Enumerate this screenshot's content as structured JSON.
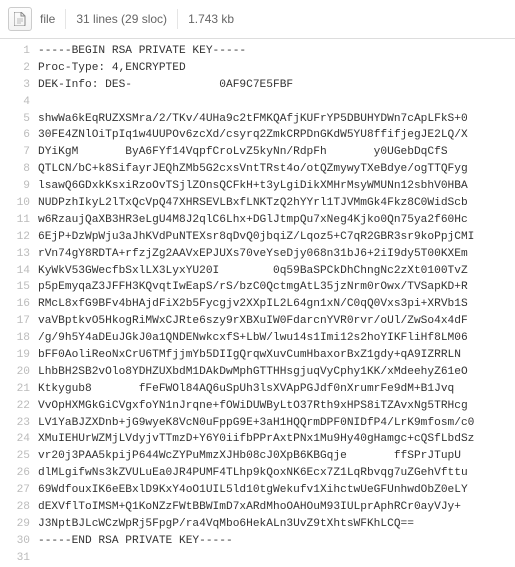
{
  "toolbar": {
    "filename": "file",
    "meta": "31 lines (29 sloc)",
    "size": "1.743 kb"
  },
  "code": {
    "lines": [
      "-----BEGIN RSA PRIVATE KEY-----",
      "Proc-Type: 4,ENCRYPTED",
      "DEK-Info: DES-             0AF9C7E5FBF",
      "",
      "shwWa6kEqRUZXSMra/2/TKv/4UHa9c2tFMKQAfjKUFrYP5DBUHYDWn7cApLFkS+0",
      "30FE4ZNlOiTpIq1w4UUPOv6zcXd/csyrq2ZmkCRPDnGKdW5YU8ffifjegJE2LQ/X",
      "DYiKgM       ByA6FYf14VqpfCroLvZ5kyNn/RdpFh       y0UGebDqCfS",
      "QTLCN/bC+k8SifayrJEQhZMb5G2cxsVntTRst4o/otQZmywyTXeBdye/ogTTQFyg",
      "lsawQ6GDxkKsxiRzoOvTSjlZOnsQCFkH+t3yLgiDikXMHrMsyWMUNn12sbhV0HBA",
      "NUDPzhIkyL2lTxQcVpQ47XHRSEVLBxfLNKTzQ2hYYrl1TJVMmGk4Fkz8C0WidScb",
      "w6RzaujQaXB3HR3eLgU4M8J2qlC6Lhx+DGlJtmpQu7xNeg4Kjko0Qn75ya2f60Hc",
      "6EjP+DzWpWju3aJhKVdPuNTEXsr8qDvQ0jbqiZ/Lqoz5+C7qR2GBR3sr9koPpjCMI",
      "rVn74gY8RDTA+rfzjZg2AAVxEPJUXs70veYseDjy068n31bJ6+2iI9dy5T00KXEm",
      "KyWkV53GWecfbSxlLX3LyxYU20I        0q59BaSPCkDhChngNc2zXt0100TvZ",
      "p5pEmyqaZ3JFFH3KQvqtIwEapS/rS/bzC0QctmgAtL35jzNrm0rOwx/TVSapKD+R",
      "RMcL8xfG9BFv4bHAjdFiX2b5Fycgjv2XXpIL2L64gn1xN/C0qQ0Vxs3pi+XRVb1S",
      "vaVBptkvO5HkogRiMWxCJRte6szy9rXBXuIW0FdarcnYVR0rvr/oUl/ZwSo4x4dF",
      "/g/9h5Y4aDEuJGkJ0a1QNDENwkcxfS+LbW/lwu14s1Imi12s2hoYIKFliHf8LM06",
      "bFF0AoliReoNxCrU6TMfjjmYb5DIIgQrqwXuvCumHbaxorBxZ1gdy+qA9IZRRLN",
      "LhbBH2SB2vOlo8YDHZUXbdM1DAkDwMphGTTHHsgjuqVyCphy1KK/xMdeehyZ61eO",
      "Ktkygub8       fFeFWOl84AQ6uSpUh3lsXVApPGJdf0nXrumrFe9dM+B1Jvq",
      "VvOpHXMGkGiCVgxfoYN1nJrqne+fOWiDUWByLtO37Rth9xHPS8iTZAvxNg5TRHcg",
      "LV1YaBJZXDnb+jG9wyeK8VcN0uFppG9E+3aH1HQQrmDPF0NIDfP4/LrK9mfosm/c0",
      "XMuIEHUrWZMjLVdyjvTTmzD+Y6Y0iifbPPrAxtPNx1Mu9Hy40gHamgc+cQSfLbdSz",
      "vr20j3PAA5kpijP644WcZYPuMmzXJHb08cJ0XpB6KBGqje       ffSPrJTupU",
      "dlMLgifwNs3kZVULuEa0JR4PUMF4TLhp9kQoxNK6Ecx7Z1LqRbvqg7uZGehVfttu",
      "69WdfouxIK6eEBxlD9KxY4oO1UIL5ld10tgWekufv1XihctwUeGFUnhwdObZ0eLY",
      "dEXVflToIMSM+Q1KoNZzFWtBBWImD7xARdMhoOAHOuM93IULprAphRCr0ayVJy+",
      "J3NptBJLcWCzWpRj5FpgP/ra4VqMbo6HekALn3UvZ9tXhtsWFKhLCQ==",
      "-----END RSA PRIVATE KEY-----",
      ""
    ]
  }
}
